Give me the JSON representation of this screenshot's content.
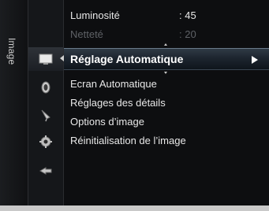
{
  "tab": {
    "label": "Image"
  },
  "sidebar": {
    "icons": [
      "picture-icon",
      "sound-icon",
      "channel-icon",
      "setup-icon",
      "input-icon"
    ]
  },
  "menu": {
    "rows": [
      {
        "label": "Luminosité",
        "value": ": 45",
        "dimmed": false
      },
      {
        "label": "Netteté",
        "value": ": 20",
        "dimmed": true
      }
    ],
    "selected": {
      "label": "Réglage Automatique"
    },
    "items": [
      {
        "label": "Ecran Automatique"
      },
      {
        "label": "Réglages des détails"
      },
      {
        "label": "Options d’image"
      },
      {
        "label": "Réinitialisation de l’image"
      }
    ]
  },
  "colors": {
    "background": "#0d0e10",
    "highlight": "#2f3a45",
    "text": "#e8e8e8",
    "dim_text": "#5e6166"
  }
}
